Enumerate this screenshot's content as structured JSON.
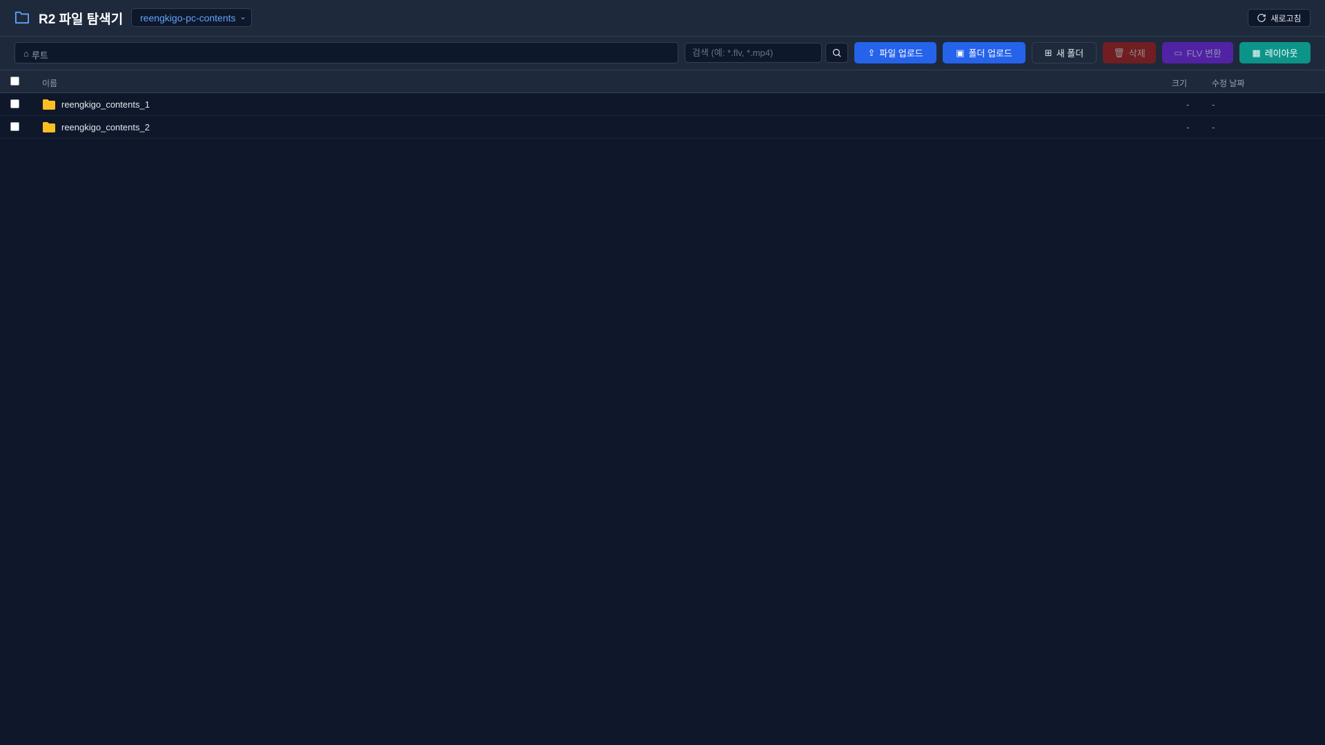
{
  "header": {
    "title": "R2 파일 탐색기",
    "bucket": "reengkigo-pc-contents",
    "refresh_label": "새로고침"
  },
  "toolbar": {
    "breadcrumb_root": "루트",
    "search_placeholder": "검색 (예: *.flv, *.mp4)",
    "upload_file": "파일 업로드",
    "upload_folder": "폴더 업로드",
    "new_folder": "새 폴더",
    "delete": "삭제",
    "flv_convert": "FLV 변환",
    "layout": "레이아웃"
  },
  "table": {
    "columns": {
      "name": "이름",
      "size": "크기",
      "modified": "수정 날짜"
    },
    "rows": [
      {
        "name": "reengkigo_contents_1",
        "size": "-",
        "modified": "-"
      },
      {
        "name": "reengkigo_contents_2",
        "size": "-",
        "modified": "-"
      }
    ]
  },
  "colors": {
    "primary": "#2563eb",
    "danger": "#7f1d1d",
    "purple": "#5b21b6",
    "teal": "#0d9488",
    "folder": "#fbbf24"
  }
}
